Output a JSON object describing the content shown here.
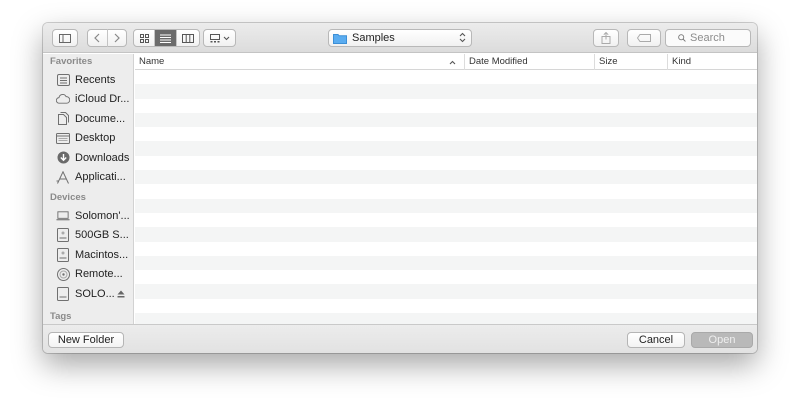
{
  "toolbar": {
    "path_popup_label": "Samples",
    "search_placeholder": "Search",
    "view_modes": [
      "icon",
      "list",
      "column",
      "gallery"
    ],
    "active_view": "list"
  },
  "sidebar": {
    "favorites_heading": "Favorites",
    "favorites": [
      {
        "label": "Recents",
        "icon": "recents-icon"
      },
      {
        "label": "iCloud Dr...",
        "icon": "cloud-icon"
      },
      {
        "label": "Docume...",
        "icon": "documents-icon"
      },
      {
        "label": "Desktop",
        "icon": "desktop-icon"
      },
      {
        "label": "Downloads",
        "icon": "downloads-icon"
      },
      {
        "label": "Applicati...",
        "icon": "applications-icon"
      }
    ],
    "devices_heading": "Devices",
    "devices": [
      {
        "label": "Solomon'...",
        "icon": "laptop-icon"
      },
      {
        "label": "500GB S...",
        "icon": "disk-icon"
      },
      {
        "label": "Macintos...",
        "icon": "disk-icon"
      },
      {
        "label": "Remote...",
        "icon": "remote-disc-icon"
      },
      {
        "label": "SOLO...",
        "icon": "external-drive-icon",
        "eject": true
      }
    ],
    "tags_heading": "Tags"
  },
  "list": {
    "columns": [
      "Name",
      "Date Modified",
      "Size",
      "Kind"
    ],
    "sorted_by": "Name"
  },
  "buttons": {
    "new_folder": "New Folder",
    "cancel": "Cancel",
    "open": "Open"
  },
  "colors": {
    "sidebar_bg": "#ededed",
    "toolbar_bg": "#dcdcdc",
    "row_stripe": "#f4f5f5",
    "open_button_disabled": "#b9b9b9"
  }
}
